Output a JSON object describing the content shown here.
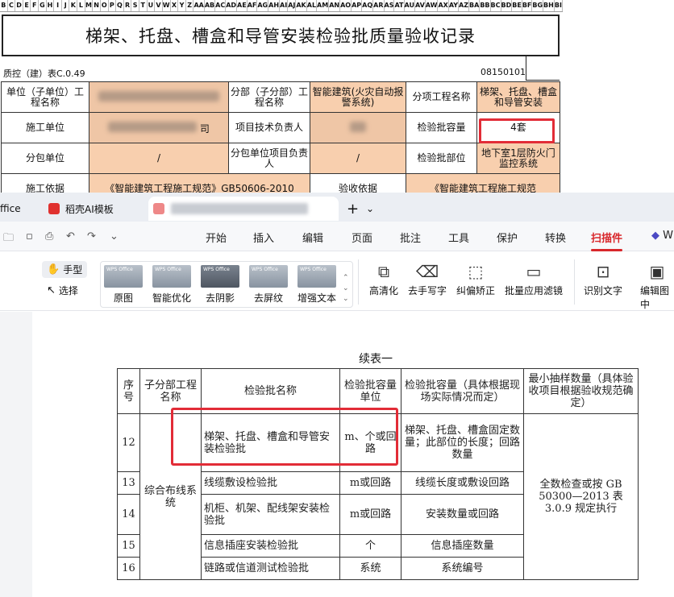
{
  "sheet": {
    "column_letters": [
      "B",
      "C",
      "D",
      "E",
      "F",
      "G",
      "H",
      "I",
      "J",
      "K",
      "L",
      "M",
      "N",
      "O",
      "P",
      "Q",
      "R",
      "S",
      "T",
      "U",
      "V",
      "W",
      "X",
      "Y",
      "Z",
      "AA",
      "AB",
      "AC",
      "AD",
      "AE",
      "AF",
      "AG",
      "AH",
      "AI",
      "AJ",
      "AK",
      "AL",
      "AM",
      "AN",
      "AO",
      "AP",
      "AQ",
      "AR",
      "AS",
      "AT",
      "AU",
      "AV",
      "AW",
      "AX",
      "AY",
      "AZ",
      "BA",
      "BB",
      "BC",
      "BD",
      "BE",
      "BF",
      "BG",
      "BH",
      "BI"
    ],
    "title": "梯架、托盘、槽盒和导管安装检验批质量验收记录",
    "form_code": "质控（建）表C.0.49",
    "serial": "08150101",
    "rows": [
      [
        "单位（子单位）工程名称",
        "",
        "分部（子分部）工程名称",
        "智能建筑(火灾自动报警系统)",
        "分项工程名称",
        "梯架、托盘、槽盒和导管安装"
      ],
      [
        "施工单位",
        "",
        "项目技术负责人",
        "",
        "检验批容量",
        "4套"
      ],
      [
        "分包单位",
        "/",
        "分包单位项目负责人",
        "/",
        "检验批部位",
        "地下室1层防火门监控系统"
      ],
      [
        "施工依据",
        "《智能建筑工程施工规范》GB50606-2010",
        "验收依据",
        "《智能建筑工程施工规范"
      ]
    ],
    "blurred_suffix_1": "司",
    "blurred_suffix_2": "司"
  },
  "tabs": {
    "office_tab": "ffice",
    "ai_tab": "稻壳AI模板",
    "new_tab": "+",
    "dropdown": "⌄"
  },
  "ribbon_menu": [
    "开始",
    "插入",
    "编辑",
    "页面",
    "批注",
    "工具",
    "保护",
    "转换",
    "扫描件",
    "W"
  ],
  "ribbon_active": "扫描件",
  "toolbar": {
    "hand_label": "手型",
    "select_label": "选择",
    "thumbs": [
      "原图",
      "智能优化",
      "去阴影",
      "去屏纹",
      "增强文本"
    ],
    "big_tools": [
      "高清化",
      "去手写字",
      "纠偏矫正",
      "批量应用滤镜",
      "识别文字",
      "编辑图中"
    ]
  },
  "scan": {
    "continued_title": "续表一",
    "header": [
      "序号",
      "子分部工程名称",
      "检验批名称",
      "检验批容量单位",
      "检验批容量（具体根据现场实际情况而定）",
      "最小抽样数量（具体验收项目根据验收规范确定）"
    ],
    "rows": [
      [
        "12",
        "梯架、托盘、槽盒和导管安装检验批",
        "m、个或回路",
        "梯架、托盘、槽盒固定数量；此部位的长度；回路数量"
      ],
      [
        "13",
        "线缆敷设检验批",
        "m或回路",
        "线缆长度或敷设回路"
      ],
      [
        "14",
        "机柜、机架、配线架安装检验批",
        "m或回路",
        "安装数量或回路"
      ],
      [
        "15",
        "信息插座安装检验批",
        "个",
        "信息插座数量"
      ],
      [
        "16",
        "链路或信道测试检验批",
        "系统",
        "系统编号"
      ]
    ],
    "subsystem": "综合布线系统",
    "sampling": "全数检查或按 GB 50300—2013 表 3.0.9 规定执行"
  }
}
